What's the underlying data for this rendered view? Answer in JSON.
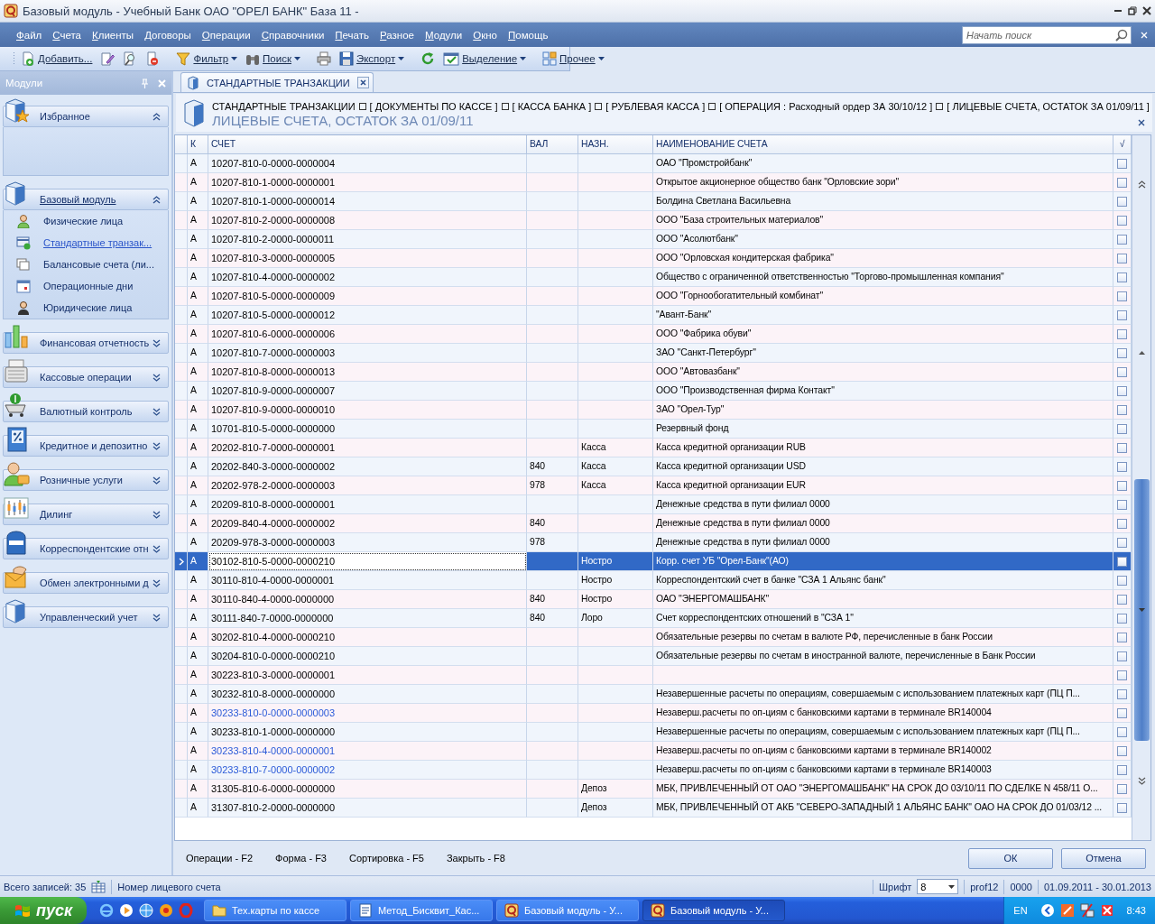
{
  "window": {
    "title": "Базовый модуль - Учебный Банк ОАО \"ОРЕЛ БАНК\" База 11 -"
  },
  "menu": [
    "Файл",
    "Счета",
    "Клиенты",
    "Договоры",
    "Операции",
    "Справочники",
    "Печать",
    "Разное",
    "Модули",
    "Окно",
    "Помощь"
  ],
  "search": {
    "placeholder": "Начать поиск"
  },
  "toolbar": [
    {
      "kind": "button",
      "label": "Добавить...",
      "dropdown": false
    },
    {
      "kind": "icon"
    },
    {
      "kind": "icon"
    },
    {
      "kind": "icon"
    },
    {
      "kind": "separator"
    },
    {
      "kind": "button",
      "label": "Фильтр",
      "dropdown": true
    },
    {
      "kind": "button",
      "label": "Поиск",
      "dropdown": true
    },
    {
      "kind": "separator"
    },
    {
      "kind": "icon"
    },
    {
      "kind": "button",
      "label": "Экспорт",
      "dropdown": true
    },
    {
      "kind": "separator"
    },
    {
      "kind": "icon"
    },
    {
      "kind": "button",
      "label": "Выделение",
      "dropdown": true
    },
    {
      "kind": "separator"
    },
    {
      "kind": "button",
      "label": "Прочее",
      "dropdown": true
    }
  ],
  "sidebar": {
    "title": "Модули",
    "groups": [
      {
        "label": "Избранное",
        "expanded": true,
        "selected": false
      },
      {
        "label": "Базовый модуль",
        "expanded": true,
        "selected": true,
        "items": [
          {
            "label": "Физические лица",
            "selected": false
          },
          {
            "label": "Стандартные транзак...",
            "selected": true
          },
          {
            "label": "Балансовые счета (ли...",
            "selected": false
          },
          {
            "label": "Операционные дни",
            "selected": false
          },
          {
            "label": "Юридические лица",
            "selected": false
          }
        ]
      },
      {
        "label": "Финансовая отчетность",
        "expanded": false,
        "selected": false
      },
      {
        "label": "Кассовые операции",
        "expanded": false,
        "selected": false
      },
      {
        "label": "Валютный контроль",
        "expanded": false,
        "selected": false
      },
      {
        "label": "Кредитное и депозитно",
        "expanded": false,
        "selected": false
      },
      {
        "label": "Розничные услуги",
        "expanded": false,
        "selected": false
      },
      {
        "label": "Дилинг",
        "expanded": false,
        "selected": false
      },
      {
        "label": "Корреспондентские отн",
        "expanded": false,
        "selected": false
      },
      {
        "label": "Обмен электронными д",
        "expanded": false,
        "selected": false
      },
      {
        "label": "Управленческий учет",
        "expanded": false,
        "selected": false
      }
    ]
  },
  "tab": {
    "label": "СТАНДАРТНЫЕ ТРАНЗАКЦИИ"
  },
  "breadcrumb": [
    "СТАНДАРТНЫЕ ТРАНЗАКЦИИ",
    "[ ДОКУМЕНТЫ ПО КАССЕ ]",
    "[ КАССА БАНКА ]",
    "[ РУБЛЕВАЯ КАССА ]",
    "[ ОПЕРАЦИЯ : Расходный ордер ЗА 30/10/12 ]",
    "[ ЛИЦЕВЫЕ СЧЕТА, ОСТАТОК ЗА 01/09/11 ]"
  ],
  "heading": "ЛИЦЕВЫЕ СЧЕТА, ОСТАТОК ЗА 01/09/11",
  "table": {
    "columns": [
      "К",
      "СЧЕТ",
      "ВАЛ",
      "НАЗН.",
      "НАИМЕНОВАНИЕ СЧЕТА",
      "√"
    ],
    "rows": [
      {
        "k": "А",
        "account": "10207-810-0-0000-0000004",
        "currency": "",
        "purpose": "",
        "name": "ОАО \"Промстройбанк\"",
        "checked": false,
        "selected": false
      },
      {
        "k": "А",
        "account": "10207-810-1-0000-0000001",
        "currency": "",
        "purpose": "",
        "name": "Открытое акционерное общество банк \"Орловские зори\"",
        "checked": false,
        "selected": false
      },
      {
        "k": "А",
        "account": "10207-810-1-0000-0000014",
        "currency": "",
        "purpose": "",
        "name": "Болдина Светлана Васильевна",
        "checked": false,
        "selected": false
      },
      {
        "k": "А",
        "account": "10207-810-2-0000-0000008",
        "currency": "",
        "purpose": "",
        "name": "ООО \"База строительных материалов\"",
        "checked": false,
        "selected": false
      },
      {
        "k": "А",
        "account": "10207-810-2-0000-0000011",
        "currency": "",
        "purpose": "",
        "name": "ООО \"Асолютбанк\"",
        "checked": false,
        "selected": false
      },
      {
        "k": "А",
        "account": "10207-810-3-0000-0000005",
        "currency": "",
        "purpose": "",
        "name": "ООО \"Орловская кондитерская фабрика\"",
        "checked": false,
        "selected": false
      },
      {
        "k": "А",
        "account": "10207-810-4-0000-0000002",
        "currency": "",
        "purpose": "",
        "name": "Общество с ограниченной ответственностью \"Торгово-промышленная компания\"",
        "checked": false,
        "selected": false
      },
      {
        "k": "А",
        "account": "10207-810-5-0000-0000009",
        "currency": "",
        "purpose": "",
        "name": "ООО \"Горнообогатительный комбинат\"",
        "checked": false,
        "selected": false
      },
      {
        "k": "А",
        "account": "10207-810-5-0000-0000012",
        "currency": "",
        "purpose": "",
        "name": "\"Авант-Банк\"",
        "checked": false,
        "selected": false
      },
      {
        "k": "А",
        "account": "10207-810-6-0000-0000006",
        "currency": "",
        "purpose": "",
        "name": "ООО \"Фабрика обуви\"",
        "checked": false,
        "selected": false
      },
      {
        "k": "А",
        "account": "10207-810-7-0000-0000003",
        "currency": "",
        "purpose": "",
        "name": "ЗАО \"Санкт-Петербург\"",
        "checked": false,
        "selected": false
      },
      {
        "k": "А",
        "account": "10207-810-8-0000-0000013",
        "currency": "",
        "purpose": "",
        "name": "ООО \"Автовазбанк\"",
        "checked": false,
        "selected": false
      },
      {
        "k": "А",
        "account": "10207-810-9-0000-0000007",
        "currency": "",
        "purpose": "",
        "name": "ООО \"Производственная фирма Контакт\"",
        "checked": false,
        "selected": false
      },
      {
        "k": "А",
        "account": "10207-810-9-0000-0000010",
        "currency": "",
        "purpose": "",
        "name": "ЗАО \"Орел-Тур\"",
        "checked": false,
        "selected": false
      },
      {
        "k": "А",
        "account": "10701-810-5-0000-0000000",
        "currency": "",
        "purpose": "",
        "name": "Резервный фонд",
        "checked": false,
        "selected": false
      },
      {
        "k": "А",
        "account": "20202-810-7-0000-0000001",
        "currency": "",
        "purpose": "Касса",
        "name": "Касса кредитной организации RUB",
        "checked": false,
        "selected": false
      },
      {
        "k": "А",
        "account": "20202-840-3-0000-0000002",
        "currency": "840",
        "purpose": "Касса",
        "name": "Касса кредитной организации USD",
        "checked": false,
        "selected": false
      },
      {
        "k": "А",
        "account": "20202-978-2-0000-0000003",
        "currency": "978",
        "purpose": "Касса",
        "name": "Касса кредитной организации EUR",
        "checked": false,
        "selected": false
      },
      {
        "k": "А",
        "account": "20209-810-8-0000-0000001",
        "currency": "",
        "purpose": "",
        "name": "Денежные средства в пути филиал 0000",
        "checked": false,
        "selected": false
      },
      {
        "k": "А",
        "account": "20209-840-4-0000-0000002",
        "currency": "840",
        "purpose": "",
        "name": "Денежные средства в пути филиал 0000",
        "checked": false,
        "selected": false
      },
      {
        "k": "А",
        "account": "20209-978-3-0000-0000003",
        "currency": "978",
        "purpose": "",
        "name": "Денежные средства в пути филиал 0000",
        "checked": false,
        "selected": false
      },
      {
        "k": "А",
        "account": "30102-810-5-0000-0000210",
        "currency": "",
        "purpose": "Ностро",
        "name": "Корр. счет УБ \"Орел-Банк\"(АО)",
        "checked": false,
        "selected": true
      },
      {
        "k": "А",
        "account": "30110-810-4-0000-0000001",
        "currency": "",
        "purpose": "Ностро",
        "name": "Корреспондентский счет в банке \"СЗА 1 Альянс банк\"",
        "checked": false,
        "selected": false
      },
      {
        "k": "А",
        "account": "30110-840-4-0000-0000000",
        "currency": "840",
        "purpose": "Ностро",
        "name": "ОАО \"ЭНЕРГОМАШБАНК\"",
        "checked": false,
        "selected": false
      },
      {
        "k": "А",
        "account": "30111-840-7-0000-0000000",
        "currency": "840",
        "purpose": "Лоро",
        "name": "Счет корреспондентских отношений в \"СЗА 1\"",
        "checked": false,
        "selected": false
      },
      {
        "k": "А",
        "account": "30202-810-4-0000-0000210",
        "currency": "",
        "purpose": "",
        "name": "Обязательные резервы по счетам в валюте РФ, перечисленные в банк России",
        "checked": false,
        "selected": false
      },
      {
        "k": "А",
        "account": "30204-810-0-0000-0000210",
        "currency": "",
        "purpose": "",
        "name": "Обязательные резервы по счетам в иностранной валюте, перечисленные в Банк России",
        "checked": false,
        "selected": false
      },
      {
        "k": "А",
        "account": "30223-810-3-0000-0000001",
        "currency": "",
        "purpose": "",
        "name": "",
        "checked": false,
        "selected": false
      },
      {
        "k": "А",
        "account": "30232-810-8-0000-0000000",
        "currency": "",
        "purpose": "",
        "name": "Незавершенные расчеты по операциям, совершаемым с использованием платежных карт (ПЦ П...",
        "checked": false,
        "selected": false
      },
      {
        "k": "А",
        "account": "30233-810-0-0000-0000003",
        "currency": "",
        "purpose": "",
        "name": "Незаверш.расчеты по оп-циям с банковскими картами в терминале BR140004",
        "color": "#2a5ad8",
        "checked": false,
        "selected": false
      },
      {
        "k": "А",
        "account": "30233-810-1-0000-0000000",
        "currency": "",
        "purpose": "",
        "name": "Незавершенные расчеты по операциям, совершаемым с использованием платежных карт (ПЦ П...",
        "checked": false,
        "selected": false
      },
      {
        "k": "А",
        "account": "30233-810-4-0000-0000001",
        "currency": "",
        "purpose": "",
        "name": "Незаверш.расчеты по оп-циям с банковскими картами в терминале BR140002",
        "color": "#2a5ad8",
        "checked": false,
        "selected": false
      },
      {
        "k": "А",
        "account": "30233-810-7-0000-0000002",
        "currency": "",
        "purpose": "",
        "name": "Незаверш.расчеты по оп-циям с банковскими картами в терминале BR140003",
        "color": "#2a5ad8",
        "checked": false,
        "selected": false
      },
      {
        "k": "А",
        "account": "31305-810-6-0000-0000000",
        "currency": "",
        "purpose": "Депоз",
        "name": "МБК, ПРИВЛЕЧЕННЫЙ ОТ ОАО \"ЭНЕРГОМАШБАНК\" НА СРОК ДО 03/10/11 ПО СДЕЛКЕ N 458/11 О...",
        "checked": false,
        "selected": false
      },
      {
        "k": "А",
        "account": "31307-810-2-0000-0000000",
        "currency": "",
        "purpose": "Депоз",
        "name": "МБК, ПРИВЛЕЧЕННЫЙ ОТ АКБ \"СЕВЕРО-ЗАПАДНЫЙ 1 АЛЬЯНС БАНК\" ОАО НА СРОК ДО 01/03/12 ...",
        "checked": false,
        "selected": false
      }
    ]
  },
  "shortcuts": [
    "Операции - F2",
    "Форма - F3",
    "Сортировка - F5",
    "Закрыть - F8"
  ],
  "buttons": [
    "ОК",
    "Отмена"
  ],
  "status_bar": {
    "records": "Всего записей: 35",
    "field": "Номер лицевого счета",
    "font_label": "Шрифт",
    "font_size": "8",
    "user": "prof12",
    "branch": "0000",
    "period": "01.09.2011 - 30.01.2013"
  },
  "taskbar": {
    "start": "пуск",
    "tasks": [
      {
        "label": "Тех.карты по кассе",
        "selected": false
      },
      {
        "label": "Метод_Бисквит_Кас...",
        "selected": false
      },
      {
        "label": "Базовый модуль - У...",
        "selected": false
      },
      {
        "label": "Базовый модуль - У...",
        "selected": true
      }
    ],
    "language": "EN",
    "time": "8:43"
  }
}
